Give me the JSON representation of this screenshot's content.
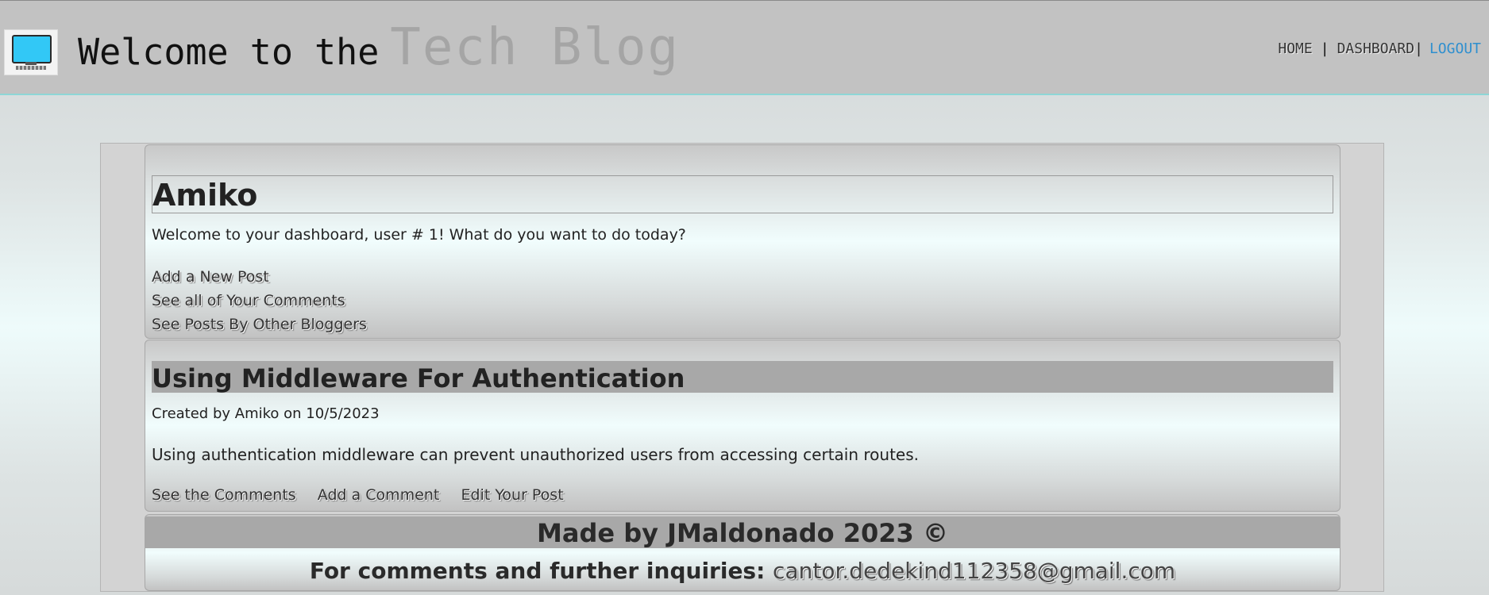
{
  "header": {
    "title_plain": "Welcome to the",
    "title_accent": "Tech Blog",
    "logo_icon": "computer-monitor-icon"
  },
  "nav": {
    "home": "HOME",
    "separator": "|",
    "dashboard": "DASHBOARD",
    "separator2": "|",
    "logout": "LOGOUT"
  },
  "dashboard": {
    "username": "Amiko",
    "welcome": "Welcome to your dashboard, user # 1! What do you want to do today?",
    "actions": [
      "Add a New Post",
      "See all of Your Comments",
      "See Posts By Other Bloggers"
    ]
  },
  "post": {
    "title": "Using Middleware For Authentication",
    "meta": "Created by Amiko on 10/5/2023",
    "body": "Using authentication middleware can prevent unauthorized users from accessing certain routes.",
    "actions": [
      "See the Comments",
      "Add a Comment",
      "Edit Your Post"
    ]
  },
  "footer": {
    "made_by": "Made by JMaldonado 2023 ©",
    "contact_label": "For comments and further inquiries:",
    "email": "cantor.dedekind112358@gmail.com"
  },
  "colors": {
    "header_bg": "#c2c2c2",
    "accent_link": "#2e8fcf",
    "title_band": "#a8a8a8",
    "logo_screen": "#32c8f6"
  }
}
